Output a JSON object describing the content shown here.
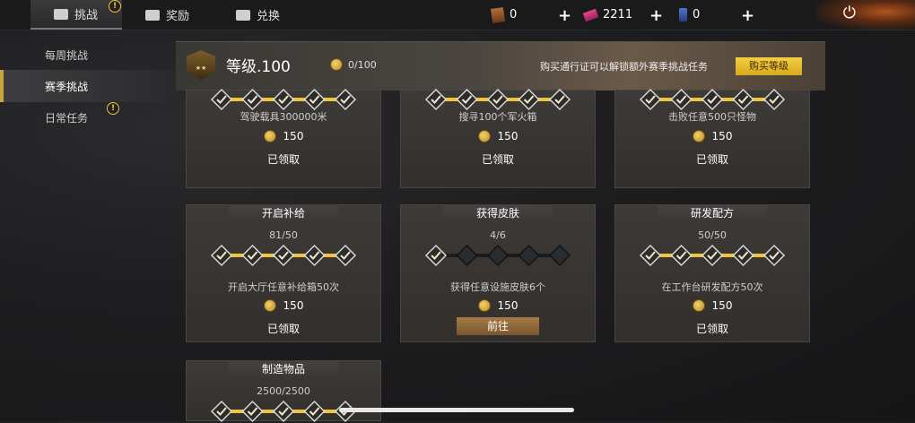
{
  "topbar": {
    "tabs": [
      {
        "label": "挑战",
        "icon": "challenge-icon",
        "active": true
      },
      {
        "label": "奖励",
        "icon": "reward-box-icon",
        "active": false
      },
      {
        "label": "兑换",
        "icon": "exchange-box-icon",
        "active": false
      }
    ],
    "resources": [
      {
        "icon": "card-icon",
        "value": "0"
      },
      {
        "icon": "ticket-icon",
        "value": "2211"
      },
      {
        "icon": "phone-icon",
        "value": "0"
      }
    ],
    "plus_label": "+",
    "power_icon": "⏻"
  },
  "sidebar": {
    "items": [
      {
        "label": "每周挑战",
        "active": false,
        "alert": false
      },
      {
        "label": "赛季挑战",
        "active": true,
        "alert": false
      },
      {
        "label": "日常任务",
        "active": false,
        "alert": true
      }
    ]
  },
  "level": {
    "title": "等级.100",
    "xp": "0/100",
    "message": "购买通行证可以解锁额外赛季挑战任务",
    "buy_label": "购买等级"
  },
  "cards_top": [
    {
      "desc": "驾驶载具300000米",
      "reward": "150",
      "status": "已领取"
    },
    {
      "desc": "搜寻100个军火箱",
      "reward": "150",
      "status": "已领取"
    },
    {
      "desc": "击败任意500只怪物",
      "reward": "150",
      "status": "已领取"
    }
  ],
  "cards_mid": [
    {
      "title": "开启补给",
      "progress": "81/50",
      "desc": "开启大厅任意补给箱50次",
      "reward": "150",
      "status": "已领取",
      "diamonds": [
        1,
        1,
        1,
        1,
        1
      ]
    },
    {
      "title": "获得皮肤",
      "progress": "4/6",
      "desc": "获得任意设施皮肤6个",
      "reward": "150",
      "status": "前往",
      "diamonds": [
        1,
        0,
        0,
        0,
        0
      ]
    },
    {
      "title": "研发配方",
      "progress": "50/50",
      "desc": "在工作台研发配方50次",
      "reward": "150",
      "status": "已领取",
      "diamonds": [
        1,
        1,
        1,
        1,
        1
      ]
    }
  ],
  "cards_bottom": [
    {
      "title": "制造物品",
      "progress": "2500/2500"
    }
  ],
  "colors": {
    "accent": "#f0c43c",
    "button": "#e6b82e",
    "card": "#383532"
  }
}
